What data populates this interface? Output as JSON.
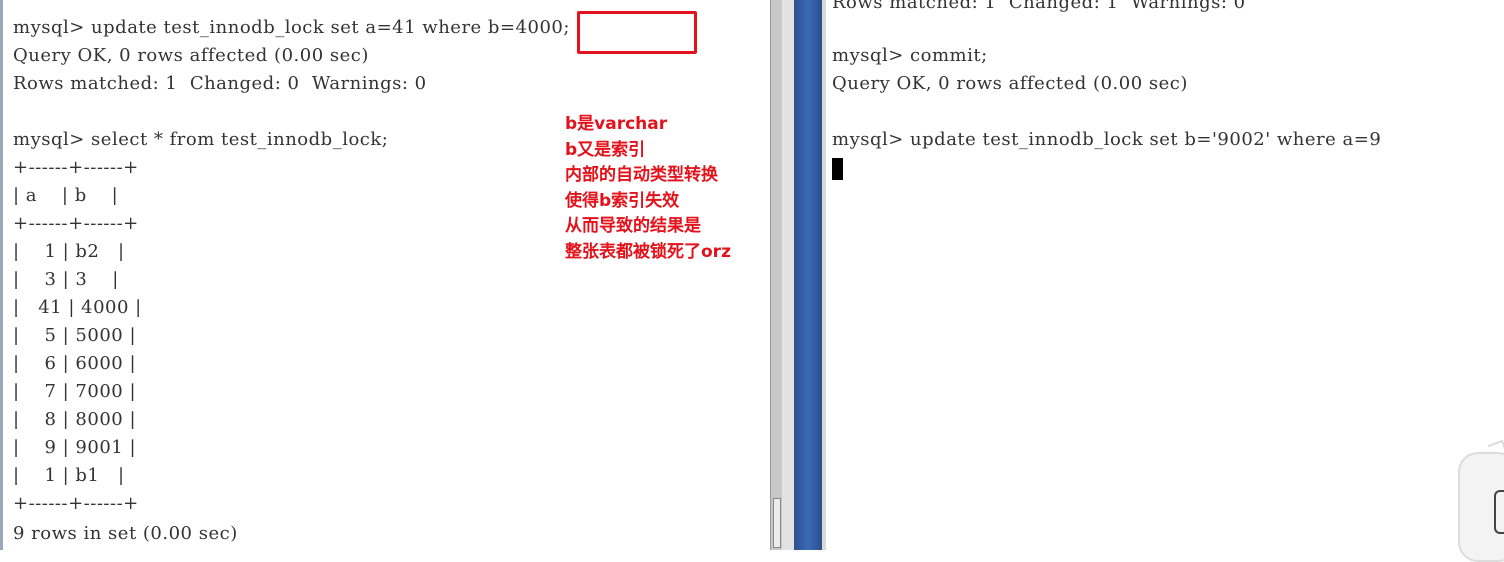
{
  "left_terminal": {
    "lines": [
      "mysql> update test_innodb_lock set a=41 where b=4000;",
      "Query OK, 0 rows affected (0.00 sec)",
      "Rows matched: 1  Changed: 0  Warnings: 0",
      "",
      "mysql> select * from test_innodb_lock;",
      "+------+------+",
      "| a    | b    |",
      "+------+------+",
      "|    1 | b2   |",
      "|    3 | 3    |",
      "|   41 | 4000 |",
      "|    5 | 5000 |",
      "|    6 | 6000 |",
      "|    7 | 7000 |",
      "|    8 | 8000 |",
      "|    9 | 9001 |",
      "|    1 | b1   |",
      "+------+------+",
      "9 rows in set (0.00 sec)"
    ]
  },
  "right_terminal": {
    "lines": [
      "Rows matched: 1  Changed: 1  Warnings: 0",
      "",
      "mysql> commit;",
      "Query OK, 0 rows affected (0.00 sec)",
      "",
      "mysql> update test_innodb_lock set b='9002' where a=9"
    ]
  },
  "annotation": {
    "lines": [
      "b是varchar",
      "b又是索引",
      "内部的自动类型转换",
      "使得b索引失效",
      "从而导致的结果是",
      "整张表都被锁死了orz"
    ],
    "color": "#e3121b"
  }
}
